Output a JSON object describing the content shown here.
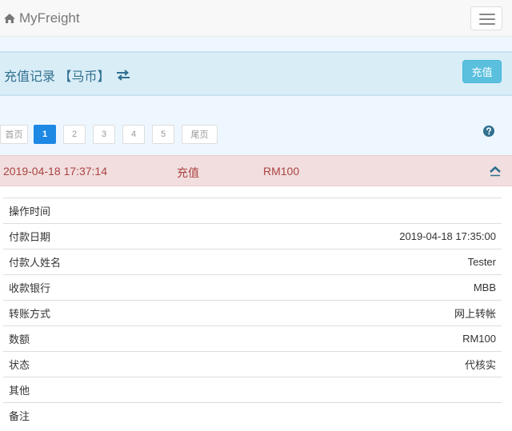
{
  "navbar": {
    "brand": "MyFreight",
    "brand_icon": "home-icon",
    "menu_icon": "hamburger-menu-icon"
  },
  "header": {
    "title": "充值记录 【马币】",
    "swap_icon": "swap-arrows-icon",
    "recharge_label": "充值",
    "accent": "#5bc0de"
  },
  "pagination": {
    "first": "首页",
    "pages": [
      "1",
      "2",
      "3",
      "4",
      "5"
    ],
    "active_page": "1",
    "last": "尾页",
    "help_icon": "question-circle-icon"
  },
  "record": {
    "time": "2019-04-18 17:37:14",
    "type": "充值",
    "amount": "RM100",
    "toggle_icon": "chevron-up-icon"
  },
  "details": [
    {
      "label": "操作时间",
      "value": ""
    },
    {
      "label": "付款日期",
      "value": "2019-04-18 17:35:00"
    },
    {
      "label": "付款人姓名",
      "value": "Tester"
    },
    {
      "label": "收款银行",
      "value": "MBB"
    },
    {
      "label": "转账方式",
      "value": "网上转帐"
    },
    {
      "label": "数额",
      "value": "RM100"
    },
    {
      "label": "状态",
      "value": "代核实"
    },
    {
      "label": "其他",
      "value": ""
    },
    {
      "label": "备注",
      "value": ""
    }
  ]
}
